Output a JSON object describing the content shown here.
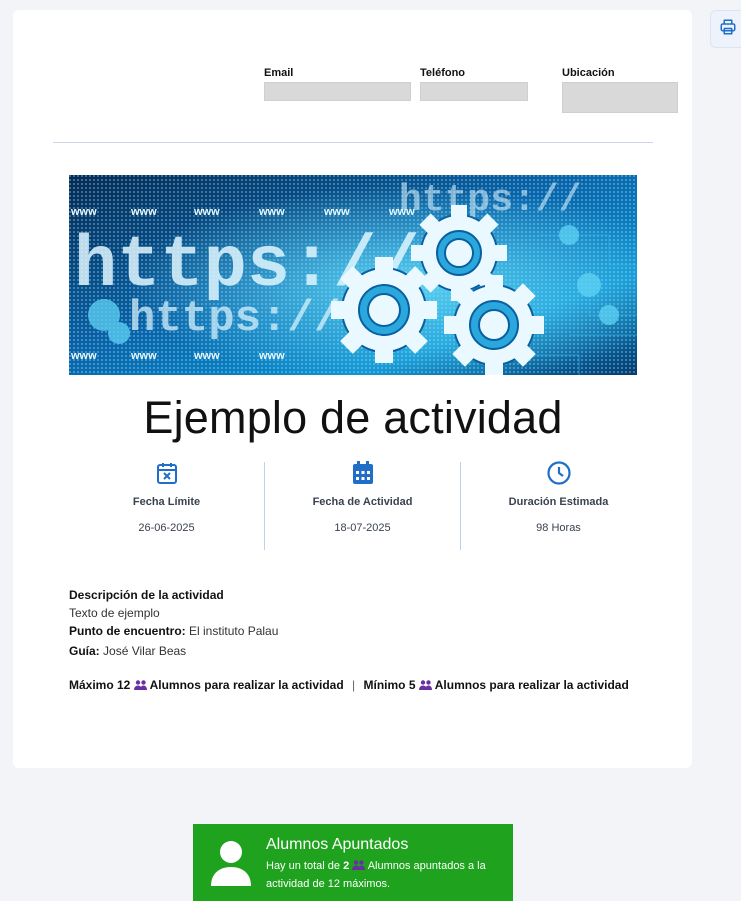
{
  "contact": {
    "email_label": "Email",
    "phone_label": "Teléfono",
    "location_label": "Ubicación"
  },
  "activity": {
    "title": "Ejemplo de actividad"
  },
  "stats": [
    {
      "icon": "calendar-x-icon",
      "label": "Fecha Límite",
      "value": "26-06-2025"
    },
    {
      "icon": "calendar-grid-icon",
      "label": "Fecha de Actividad",
      "value": "18-07-2025"
    },
    {
      "icon": "clock-icon",
      "label": "Duración Estimada",
      "value": "98 Horas"
    }
  ],
  "details": {
    "description_label": "Descripción de la actividad",
    "description_text": "Texto de ejemplo",
    "meeting_label": "Punto de encuentro:",
    "meeting_value": "El instituto Palau",
    "guide_label": "Guía:",
    "guide_value": "José Vilar Beas"
  },
  "limits": {
    "max_prefix": "Máximo 12",
    "max_suffix": "Alumnos para realizar la actividad",
    "separator": "|",
    "min_prefix": "Mínimo 5",
    "min_suffix": "Alumnos para realizar la actividad"
  },
  "enrolled": {
    "title": "Alumnos Apuntados",
    "text_prefix": "Hay un total de",
    "count": "2",
    "text_suffix": "Alumnos apuntados a la actividad de 12 máximos."
  },
  "banner": {
    "big_text": "https://",
    "small_text": "https://",
    "www": "www",
    "colors": {
      "dark": "#06223f",
      "mid": "#0a63a8",
      "bright": "#18c7f2"
    }
  },
  "colors": {
    "accent": "#1f6fc8",
    "success": "#1fa31f",
    "people": "#6a2fa0"
  }
}
